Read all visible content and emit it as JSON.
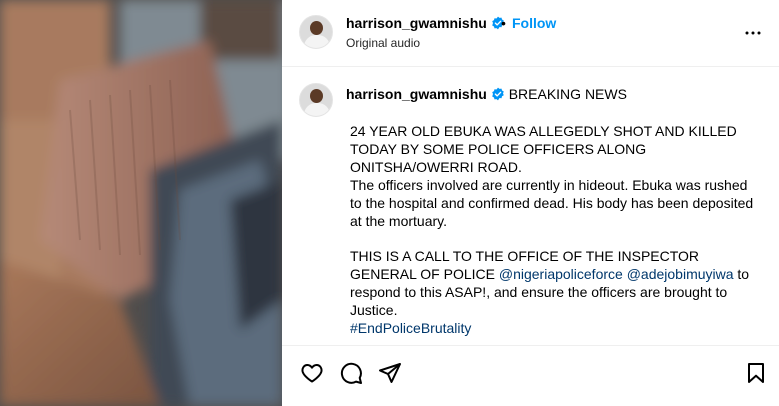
{
  "header": {
    "username": "harrison_gwamnishu",
    "separator": "•",
    "follow_label": "Follow",
    "audio_label": "Original audio",
    "more_icon": "more-horizontal-icon"
  },
  "caption": {
    "username": "harrison_gwamnishu",
    "headline": "BREAKING NEWS",
    "para1": "24 YEAR OLD EBUKA WAS ALLEGEDLY SHOT AND KILLED TODAY BY SOME POLICE OFFICERS ALONG ONITSHA/OWERRI ROAD.",
    "para2": "The officers involved are currently in hideout. Ebuka was rushed to the hospital and confirmed dead. His body has been deposited at the mortuary.",
    "para3_a": "THIS IS A CALL TO THE OFFICE OF THE INSPECTOR GENERAL OF POLICE ",
    "mention1": "@nigeriapoliceforce",
    "para3_b": " ",
    "mention2": "@adejobimuyiwa",
    "para3_c": " to respond to this ASAP!, and ensure the officers are brought to Justice.",
    "hashtag": "#EndPoliceBrutality"
  },
  "actions": {
    "like_icon": "heart-icon",
    "comment_icon": "comment-icon",
    "share_icon": "send-icon",
    "save_icon": "bookmark-icon"
  },
  "colors": {
    "accent": "#0095f6",
    "link": "#00376b",
    "verified": "#0095f6"
  }
}
